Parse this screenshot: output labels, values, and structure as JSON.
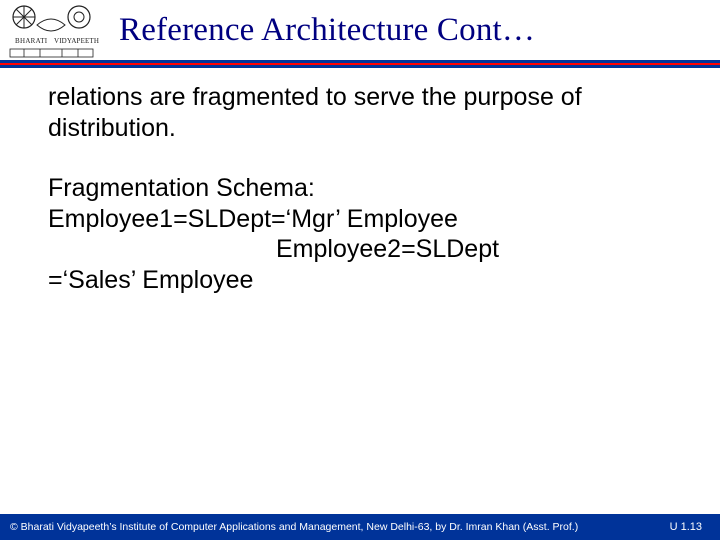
{
  "header": {
    "title": "Reference Architecture Cont…",
    "logo_alt": "Bharati Vidyapeeth emblem"
  },
  "body": {
    "p1": "relations are fragmented to serve the purpose of distribution.",
    "p2_l1": "Fragmentation Schema:",
    "p2_l2": "Employee1=SLDept=‘Mgr’ Employee",
    "p2_l3": "Employee2=SLDept",
    "p2_l4": "=‘Sales’ Employee"
  },
  "footer": {
    "copyright": "© Bharati Vidyapeeth’s Institute of Computer Applications and Management, New Delhi-63, by  Dr. Imran Khan (Asst. Prof.)",
    "pager": "U 1.13"
  }
}
